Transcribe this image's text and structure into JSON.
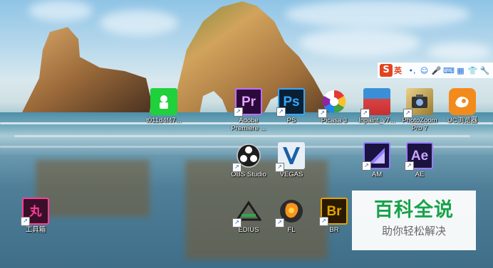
{
  "desktop": {
    "icons": [
      {
        "label": "t011d4f47...",
        "glyph": "",
        "bg": "#1fd13a",
        "icon": "green-app-icon"
      },
      {
        "label": "Adobe Premiere ...",
        "glyph": "Pr",
        "bg": "#2a0a3a",
        "fg": "#e6a2ff",
        "icon": "premiere-icon"
      },
      {
        "label": "PS",
        "glyph": "Ps",
        "bg": "#0b1f33",
        "fg": "#31a8ff",
        "icon": "photoshop-icon"
      },
      {
        "label": "Picasa 3",
        "glyph": "",
        "bg": "transparent",
        "icon": "picasa-icon"
      },
      {
        "label": "Inpaint_v7...",
        "glyph": "",
        "bg": "#d94343",
        "icon": "inpaint-icon"
      },
      {
        "label": "PhotoZoom Pro 7",
        "glyph": "",
        "bg": "#c9a24a",
        "icon": "photozoom-icon"
      },
      {
        "label": "UC浏览器",
        "glyph": "",
        "bg": "#f28a1c",
        "icon": "uc-browser-icon"
      },
      {
        "label": "OBS Studio",
        "glyph": "",
        "bg": "transparent",
        "icon": "obs-icon"
      },
      {
        "label": "VEGAS",
        "glyph": "",
        "bg": "#1b5fa8",
        "icon": "vegas-icon"
      },
      {
        "label": "AM",
        "glyph": "",
        "bg": "#2a1f66",
        "icon": "media-encoder-icon"
      },
      {
        "label": "AE",
        "glyph": "Ae",
        "bg": "#1c1240",
        "fg": "#c7a6ff",
        "icon": "after-effects-icon"
      },
      {
        "label": "工具箱",
        "glyph": "丸",
        "bg": "#3a0f2a",
        "fg": "#ff3d9a",
        "icon": "toolbox-icon"
      },
      {
        "label": "EDIUS",
        "glyph": "",
        "bg": "transparent",
        "icon": "edius-icon"
      },
      {
        "label": "FL",
        "glyph": "",
        "bg": "transparent",
        "icon": "fl-studio-icon"
      },
      {
        "label": "BR",
        "glyph": "Br",
        "bg": "#2a1a00",
        "fg": "#e3a400",
        "icon": "bridge-icon"
      }
    ]
  },
  "ime_bar": {
    "logo": "S",
    "mode": "英",
    "items": [
      "punctuation-icon",
      "emoji-icon",
      "microphone-icon",
      "keyboard-icon",
      "toolbox-icon",
      "skin-icon",
      "settings-icon"
    ],
    "glyphs": [
      "•,",
      "☺",
      "🎤",
      "⌨",
      "▦",
      "👕",
      "🔧"
    ]
  },
  "watermark": {
    "title": "百科全说",
    "subtitle": "助你轻松解决"
  }
}
